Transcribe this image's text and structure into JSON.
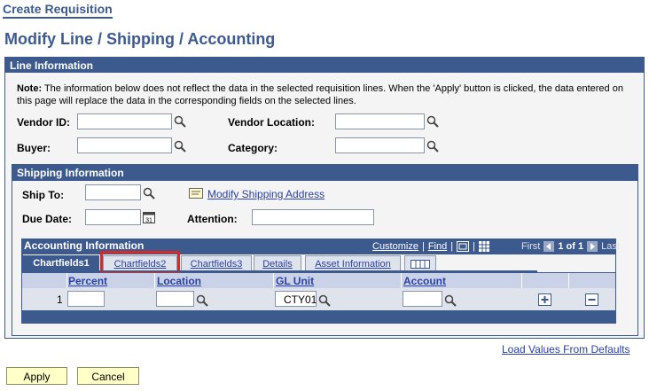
{
  "breadcrumb": "Create Requisition",
  "page_title": "Modify Line / Shipping / Accounting",
  "line_info": {
    "header": "Line Information",
    "note_prefix": "Note:",
    "note_text": " The information below does not reflect the data in the selected requisition lines. When the 'Apply' button is clicked, the data entered on this page will replace the data in the corresponding fields on the selected lines.",
    "vendor_id_label": "Vendor ID:",
    "vendor_location_label": "Vendor Location:",
    "buyer_label": "Buyer:",
    "category_label": "Category:"
  },
  "shipping": {
    "header": "Shipping Information",
    "ship_to_label": "Ship To:",
    "modify_address_link": "Modify Shipping Address",
    "due_date_label": "Due Date:",
    "attention_label": "Attention:"
  },
  "accounting": {
    "header": "Accounting Information",
    "customize": "Customize",
    "sep": "|",
    "find": "Find",
    "first": "First",
    "page_info": "1 of 1",
    "last": "Last",
    "tabs": [
      "Chartfields1",
      "Chartfields2",
      "Chartfields3",
      "Details",
      "Asset Information"
    ],
    "columns": [
      "Percent",
      "Location",
      "GL Unit",
      "Account"
    ],
    "row": {
      "num": "1",
      "gl_unit": "CTY01"
    }
  },
  "footer": {
    "load_defaults": "Load Values From Defaults",
    "apply": "Apply",
    "cancel": "Cancel"
  },
  "colors": {
    "header_blue": "#3d5a8f",
    "highlight_red": "#d42a2a",
    "link": "#2a41a5"
  }
}
